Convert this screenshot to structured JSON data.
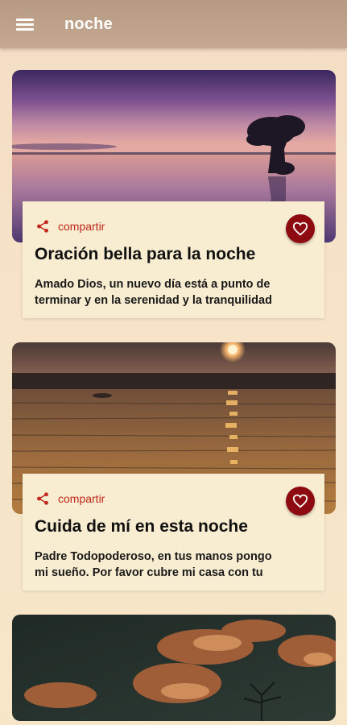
{
  "appbar": {
    "title": "noche",
    "menu_icon": "menu-icon"
  },
  "cards": [
    {
      "share_label": "compartir",
      "title": "Oración bella para la noche",
      "text_line1": "Amado Dios, un nuevo día está a punto de",
      "text_line2": "terminar y en la serenidad y la tranquilidad"
    },
    {
      "share_label": "compartir",
      "title": "Cuida de mí en esta noche",
      "text_line1": "Padre Todopoderoso, en tus manos pongo",
      "text_line2": "mi sueño. Por favor cubre mi casa con tu"
    }
  ],
  "colors": {
    "appbar": "#c4a891",
    "accent": "#c0271a",
    "favorite": "#8d0b10",
    "card_bg": "#f8ecd1"
  },
  "icons": [
    "menu-icon",
    "share-icon",
    "heart-icon"
  ]
}
